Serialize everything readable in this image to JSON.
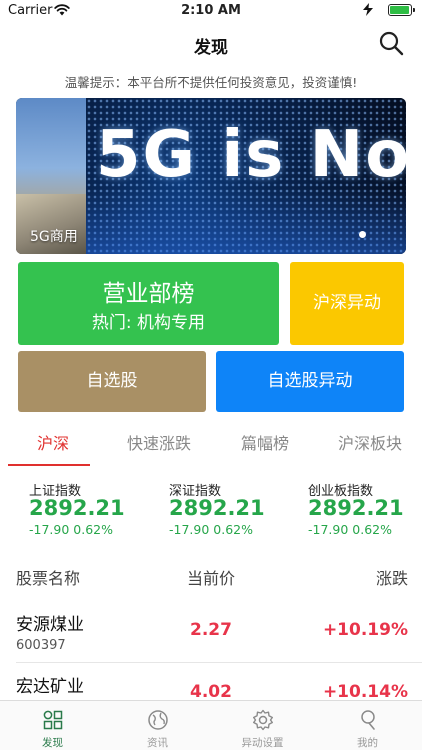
{
  "status_bar": {
    "carrier": "Carrier",
    "time": "2:10 AM"
  },
  "nav": {
    "title": "发现"
  },
  "notice": "温馨提示：本平台所不提供任何投资意见，投资谨慎!",
  "banner": {
    "left_caption": "5G商用",
    "headline": "5G is No"
  },
  "tiles": {
    "broker_title": "营业部榜",
    "broker_subtitle": "热门: 机构专用",
    "hs_move": "沪深异动",
    "watchlist": "自选股",
    "watchlist_move": "自选股异动"
  },
  "tabs": [
    "沪深",
    "快速涨跌",
    "篇幅榜",
    "沪深板块"
  ],
  "indices": [
    {
      "name": "上证指数",
      "value": "2892.21",
      "change": "-17.90  0.62%"
    },
    {
      "name": "深证指数",
      "value": "2892.21",
      "change": "-17.90  0.62%"
    },
    {
      "name": "创业板指数",
      "value": "2892.21",
      "change": "-17.90  0.62%"
    }
  ],
  "table": {
    "headers": {
      "name": "股票名称",
      "price": "当前价",
      "change": "涨跌"
    },
    "rows": [
      {
        "name": "安源煤业",
        "code": "600397",
        "price": "2.27",
        "change": "+10.19%"
      },
      {
        "name": "宏达矿业",
        "code": "",
        "price": "4.02",
        "change": "+10.14%"
      }
    ]
  },
  "tab_bar": [
    {
      "label": "发现",
      "icon": "discover-icon"
    },
    {
      "label": "资讯",
      "icon": "globe-icon"
    },
    {
      "label": "异动设置",
      "icon": "gear-icon"
    },
    {
      "label": "我的",
      "icon": "profile-icon"
    }
  ],
  "colors": {
    "accent_red": "#e0302e",
    "up_red": "#e8344a",
    "index_green": "#26a64a",
    "tile_green": "#34c24f",
    "tile_yellow": "#fbc800",
    "tile_brown": "#a99065",
    "tile_blue": "#0e84f8"
  }
}
